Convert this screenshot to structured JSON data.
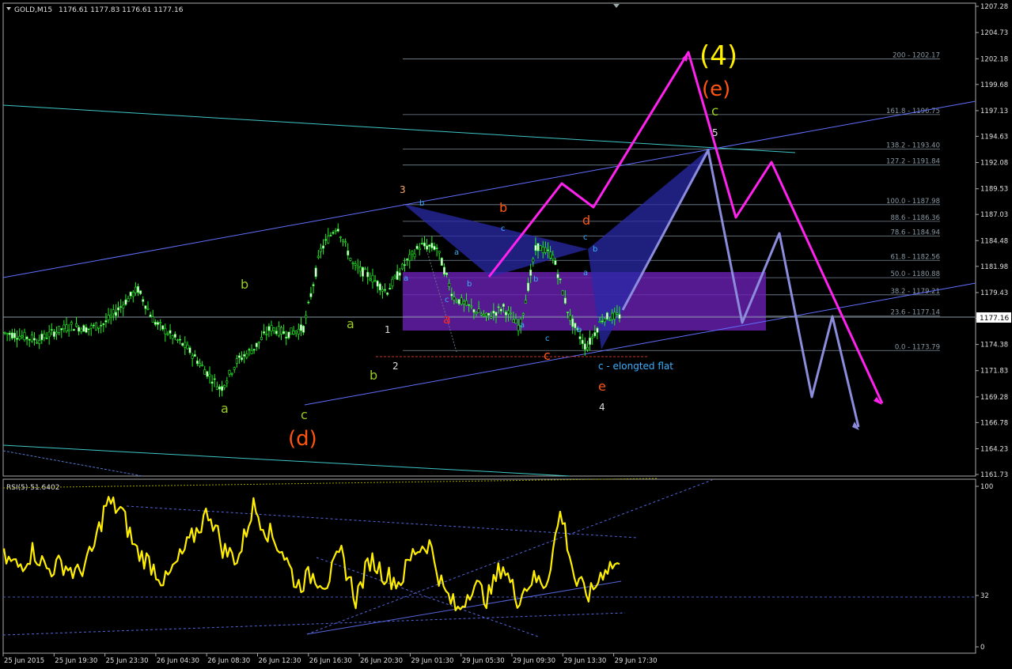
{
  "header": {
    "symbol_tf": "GOLD,M15",
    "ohlc": "1176.61 1177.83 1176.61 1177.16"
  },
  "price_axis": {
    "ticks": [
      "1207.28",
      "1204.73",
      "1202.18",
      "1199.68",
      "1197.13",
      "1194.63",
      "1192.08",
      "1189.53",
      "1187.03",
      "1184.48",
      "1181.98",
      "1179.43",
      "1176.93",
      "1174.38",
      "1171.83",
      "1169.28",
      "1166.78",
      "1164.23",
      "1161.73"
    ],
    "current_price": "1177.16"
  },
  "rsi": {
    "label": "RSI(5) 51.6402",
    "levels": [
      "100",
      "32",
      "0"
    ]
  },
  "time_axis": [
    "25 Jun 2015",
    "25 Jun 19:30",
    "25 Jun 23:30",
    "26 Jun 04:30",
    "26 Jun 08:30",
    "26 Jun 12:30",
    "26 Jun 16:30",
    "26 Jun 20:30",
    "29 Jun 01:30",
    "29 Jun 05:30",
    "29 Jun 09:30",
    "29 Jun 13:30",
    "29 Jun 17:30"
  ],
  "fibo": [
    {
      "label": "200 - 1202.17"
    },
    {
      "label": "161.8 - 1196.75"
    },
    {
      "label": "138.2 - 1193.40"
    },
    {
      "label": "127.2 - 1191.84"
    },
    {
      "label": "100.0 - 1187.98"
    },
    {
      "label": "88.6 - 1186.36"
    },
    {
      "label": "78.6 - 1184.94"
    },
    {
      "label": "61.8 - 1182.56"
    },
    {
      "label": "50.0 - 1180.88"
    },
    {
      "label": "38.2 - 1179.21"
    },
    {
      "label": "23.6 - 1177.14"
    },
    {
      "label": "0.0 - 1173.79"
    }
  ],
  "labels": {
    "big4": "(4)",
    "e_big": "(e)",
    "d_big": "(d)",
    "c_green": "c",
    "five": "5",
    "three": "3",
    "one": "1",
    "two": "2",
    "four": "4",
    "b_green": "b",
    "a_green": "a",
    "a_green2": "a",
    "b_green2": "b",
    "c_green2": "c",
    "b_red": "b",
    "d_red": "d",
    "a_red": "a",
    "c_red": "c",
    "e_red": "e",
    "b_blue": "b",
    "a_blue": "a",
    "c_blue": "c",
    "b_blue2": "b",
    "a_blue2": "a",
    "c_blue2": "c",
    "b_blue3": "b",
    "c_blue3": "c",
    "b_blue4": "b",
    "a_blue3": "a",
    "b_blue5": "b",
    "a_blue4": "a",
    "c_blue4": "c",
    "flat_note": "c - elongted flat"
  },
  "chart_data": {
    "type": "line",
    "title": "GOLD,M15",
    "ylim": [
      1161.73,
      1207.28
    ],
    "price_path_approx": [
      1175.5,
      1175.2,
      1174.8,
      1175.6,
      1176.2,
      1175.9,
      1176.4,
      1178.1,
      1179.8,
      1176.6,
      1175.3,
      1174.0,
      1172.0,
      1170.0,
      1172.8,
      1174.0,
      1176.0,
      1175.4,
      1176.0,
      1183.5,
      1186.0,
      1182.0,
      1181.0,
      1179.5,
      1182.0,
      1184.0,
      1183.8,
      1179.0,
      1178.0,
      1177.0,
      1178.0,
      1176.0,
      1184.0,
      1183.0,
      1177.0,
      1174.0,
      1177.0,
      1177.16
    ],
    "rsi_series_approx": [
      55,
      50,
      60,
      48,
      52,
      45,
      58,
      90,
      85,
      60,
      52,
      40,
      55,
      70,
      85,
      60,
      55,
      88,
      72,
      60,
      38,
      45,
      40,
      58,
      30,
      55,
      45,
      40,
      60,
      65,
      35,
      22,
      40,
      30,
      52,
      30,
      42,
      40,
      85,
      40,
      32,
      50,
      51.64
    ],
    "rsi_levels": [
      100,
      32,
      0
    ]
  }
}
